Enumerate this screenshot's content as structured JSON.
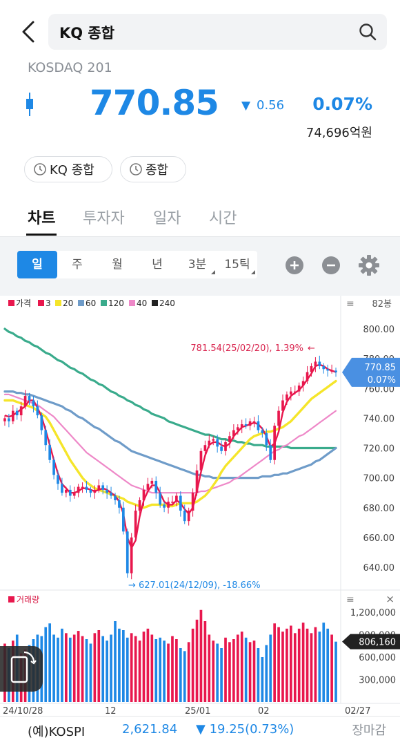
{
  "search": {
    "query": "KQ 종합"
  },
  "quote": {
    "index_name": "KOSDAQ 201",
    "price": "770.85",
    "change_arrow": "▼",
    "change": "0.56",
    "change_pct": "0.07%",
    "volume": "74,696억원"
  },
  "chips": [
    {
      "label": "KQ 종합"
    },
    {
      "label": "종합"
    }
  ],
  "tabs": [
    {
      "label": "차트",
      "active": true
    },
    {
      "label": "투자자"
    },
    {
      "label": "일자"
    },
    {
      "label": "시간"
    }
  ],
  "periods": [
    {
      "label": "일",
      "active": true
    },
    {
      "label": "주"
    },
    {
      "label": "월"
    },
    {
      "label": "년"
    },
    {
      "label": "3분",
      "dropdown": true
    },
    {
      "label": "15틱",
      "dropdown": true
    }
  ],
  "legend": [
    {
      "label": "가격",
      "color": "#e8174d"
    },
    {
      "label": "3",
      "color": "#e8174d"
    },
    {
      "label": "20",
      "color": "#f5e52a"
    },
    {
      "label": "60",
      "color": "#6f9cc9"
    },
    {
      "label": "120",
      "color": "#3aab8c"
    },
    {
      "label": "40",
      "color": "#ee88c8"
    },
    {
      "label": "240",
      "color": "#222222"
    }
  ],
  "chart_data": {
    "type": "line",
    "price_axis": {
      "labels": [
        "800.00",
        "780.00",
        "760.00",
        "740.00",
        "720.00",
        "700.00",
        "680.00",
        "660.00",
        "640.00"
      ],
      "values": [
        800,
        780,
        760,
        740,
        720,
        700,
        680,
        660,
        640
      ],
      "ylim": [
        628,
        812
      ]
    },
    "bars_count_label": "82봉",
    "current_price": {
      "price": "770.85",
      "pct": "0.07%"
    },
    "max_annotation": {
      "text": "781.54(25/02/20), 1.39%",
      "arrow": "←"
    },
    "min_annotation": {
      "text": "627.01(24/12/09), -18.66%",
      "arrow": "→"
    },
    "x_labels": [
      "24/10/28",
      "12",
      "25/01",
      "02",
      "02/27"
    ],
    "close": [
      740,
      738,
      745,
      742,
      748,
      755,
      752,
      748,
      742,
      732,
      722,
      712,
      702,
      696,
      690,
      692,
      688,
      690,
      694,
      694,
      692,
      690,
      692,
      695,
      692,
      690,
      688,
      685,
      680,
      664,
      636,
      660,
      678,
      685,
      692,
      696,
      698,
      690,
      682,
      680,
      684,
      684,
      688,
      678,
      671,
      678,
      690,
      705,
      718,
      722,
      725,
      726,
      721,
      718,
      724,
      728,
      732,
      734,
      736,
      735,
      738,
      738,
      732,
      730,
      722,
      712,
      735,
      745,
      752,
      756,
      758,
      758,
      762,
      765,
      771,
      775,
      778,
      775,
      773,
      772,
      772,
      770.85
    ],
    "ma3": [
      742,
      741,
      742,
      744,
      746,
      748,
      752,
      752,
      747,
      741,
      732,
      722,
      712,
      703,
      696,
      693,
      690,
      690,
      691,
      693,
      693,
      692,
      691,
      692,
      693,
      692,
      690,
      688,
      684,
      676,
      660,
      653,
      658,
      674,
      685,
      691,
      695,
      695,
      690,
      684,
      682,
      682,
      685,
      683,
      679,
      676,
      680,
      691,
      704,
      715,
      722,
      724,
      724,
      722,
      721,
      723,
      728,
      731,
      734,
      735,
      736,
      737,
      736,
      733,
      728,
      721,
      723,
      731,
      744,
      751,
      755,
      757,
      759,
      762,
      766,
      770,
      775,
      776,
      775,
      773,
      772,
      771
    ],
    "ma20": [
      752,
      752,
      752,
      751,
      750,
      749,
      748,
      747,
      745,
      743,
      741,
      737,
      732,
      727,
      722,
      717,
      712,
      708,
      704,
      700,
      697,
      695,
      693,
      692,
      691,
      690,
      689,
      688,
      687,
      686,
      684,
      683,
      682,
      681,
      680,
      681,
      682,
      682,
      682,
      682,
      681,
      681,
      682,
      683,
      683,
      683,
      683,
      684,
      686,
      688,
      691,
      695,
      699,
      704,
      708,
      711,
      714,
      717,
      720,
      723,
      726,
      728,
      729,
      730,
      731,
      731,
      732,
      733,
      734,
      736,
      738,
      741,
      744,
      747,
      750,
      753,
      755,
      757,
      759,
      761,
      763,
      765
    ],
    "ma40": [
      756,
      756,
      755,
      754,
      753,
      752,
      751,
      750,
      749,
      747,
      745,
      743,
      741,
      738,
      735,
      732,
      729,
      726,
      723,
      720,
      717,
      715,
      713,
      711,
      709,
      707,
      705,
      703,
      701,
      699,
      697,
      695,
      694,
      693,
      692,
      691,
      690,
      690,
      690,
      690,
      690,
      690,
      690,
      690,
      690,
      690,
      690,
      690,
      691,
      691,
      692,
      693,
      694,
      695,
      696,
      697,
      699,
      700,
      702,
      704,
      706,
      708,
      710,
      712,
      714,
      716,
      718,
      719,
      721,
      722,
      724,
      726,
      728,
      729,
      731,
      733,
      735,
      737,
      739,
      741,
      743,
      745
    ],
    "ma60": [
      758,
      758,
      758,
      757,
      757,
      756,
      756,
      755,
      754,
      753,
      752,
      751,
      750,
      749,
      748,
      746,
      745,
      743,
      741,
      740,
      738,
      736,
      734,
      733,
      731,
      729,
      727,
      725,
      724,
      722,
      720,
      718,
      717,
      716,
      715,
      714,
      713,
      712,
      711,
      710,
      709,
      708,
      707,
      706,
      705,
      704,
      703,
      702,
      702,
      701,
      701,
      700,
      700,
      700,
      700,
      700,
      700,
      700,
      700,
      700,
      700,
      700,
      700,
      701,
      701,
      701,
      702,
      702,
      703,
      703,
      704,
      705,
      706,
      707,
      708,
      709,
      711,
      712,
      714,
      716,
      718,
      720
    ],
    "ma120": [
      800,
      798,
      797,
      795,
      794,
      792,
      791,
      789,
      788,
      786,
      784,
      783,
      781,
      779,
      778,
      776,
      774,
      773,
      771,
      770,
      768,
      766,
      765,
      763,
      762,
      760,
      758,
      757,
      755,
      754,
      752,
      751,
      749,
      748,
      746,
      745,
      743,
      742,
      741,
      740,
      738,
      737,
      736,
      735,
      734,
      733,
      732,
      731,
      730,
      729,
      729,
      728,
      727,
      726,
      726,
      725,
      725,
      724,
      724,
      723,
      723,
      722,
      722,
      722,
      721,
      721,
      721,
      721,
      721,
      721,
      720,
      720,
      720,
      720,
      720,
      720,
      720,
      720,
      720,
      720,
      720,
      720
    ],
    "volume_axis": {
      "labels": [
        "1,200,000",
        "900,000",
        "600,000",
        "300,000"
      ],
      "values": [
        1200000,
        900000,
        600000,
        300000
      ]
    },
    "volume_label": "거래량",
    "current_volume": "806,160",
    "volume": [
      780000,
      720000,
      820000,
      900000,
      650000,
      700000,
      760000,
      840000,
      900000,
      880000,
      1000000,
      1050000,
      900000,
      860000,
      980000,
      920000,
      860000,
      900000,
      950000,
      880000,
      840000,
      780000,
      920000,
      960000,
      880000,
      820000,
      900000,
      1080000,
      980000,
      960000,
      860000,
      920000,
      880000,
      820000,
      940000,
      980000,
      900000,
      840000,
      860000,
      820000,
      780000,
      880000,
      840000,
      720000,
      680000,
      800000,
      980000,
      1100000,
      1230000,
      1080000,
      900000,
      820000,
      780000,
      720000,
      860000,
      800000,
      840000,
      900000,
      940000,
      860000,
      800000,
      820000,
      720000,
      600000,
      760000,
      900000,
      1050000,
      1000000,
      940000,
      980000,
      1020000,
      920000,
      980000,
      1060000,
      980000,
      920000,
      1000000,
      940000,
      1060000,
      980000,
      900000,
      806160
    ],
    "up_color": "#e8174d",
    "down_color": "#1e88e5"
  },
  "bottom": {
    "kospi_label": "(예)KOSPI",
    "kospi_price": "2,621.84",
    "kospi_change": "▼ 19.25(0.73%)",
    "status": "장마감"
  }
}
